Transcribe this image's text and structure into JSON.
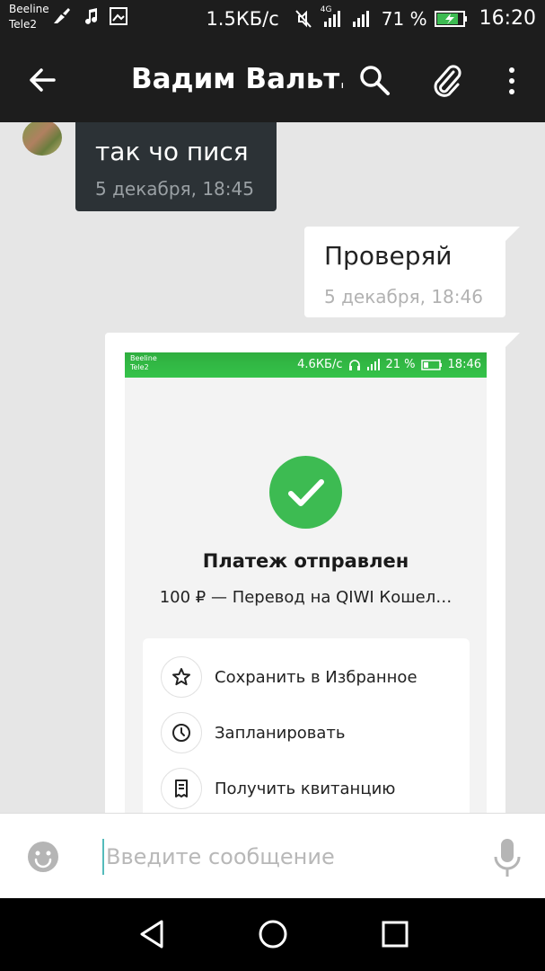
{
  "status_bar": {
    "carrier1": "Beeline",
    "carrier2": "Tele2",
    "speed": "1.5КБ/с",
    "network": "4G",
    "battery": "71 %",
    "time": "16:20"
  },
  "toolbar": {
    "title": "Вадим Вальт…",
    "icons": [
      "back-arrow-icon",
      "search-icon",
      "attach-icon",
      "more-icon"
    ]
  },
  "messages": [
    {
      "direction": "incoming",
      "text": "так чо пися",
      "time": "5 декабря, 18:45"
    },
    {
      "direction": "outgoing",
      "text": "Проверяй",
      "time": "5 декабря, 18:46"
    }
  ],
  "image_message": {
    "status_bar": {
      "carrier1": "Beeline",
      "carrier2": "Tele2",
      "speed": "4.6КБ/с",
      "battery": "21 %",
      "time": "18:46"
    },
    "title": "Платеж отправлен",
    "subtitle": "100 ₽ — Перевод на QIWI Кошел…",
    "accent_color": "#3dbb52",
    "actions": [
      {
        "label": "Сохранить в Избранное",
        "icon": "star-icon"
      },
      {
        "label": "Запланировать",
        "icon": "clock-icon"
      },
      {
        "label": "Получить квитанцию",
        "icon": "receipt-icon"
      }
    ]
  },
  "composer": {
    "placeholder": "Введите сообщение",
    "value": ""
  },
  "colors": {
    "toolbar_bg": "#1d1d1d",
    "chat_bg": "#e6e6e6",
    "incoming_bubble": "#2c3236",
    "outgoing_bubble": "#ffffff"
  }
}
